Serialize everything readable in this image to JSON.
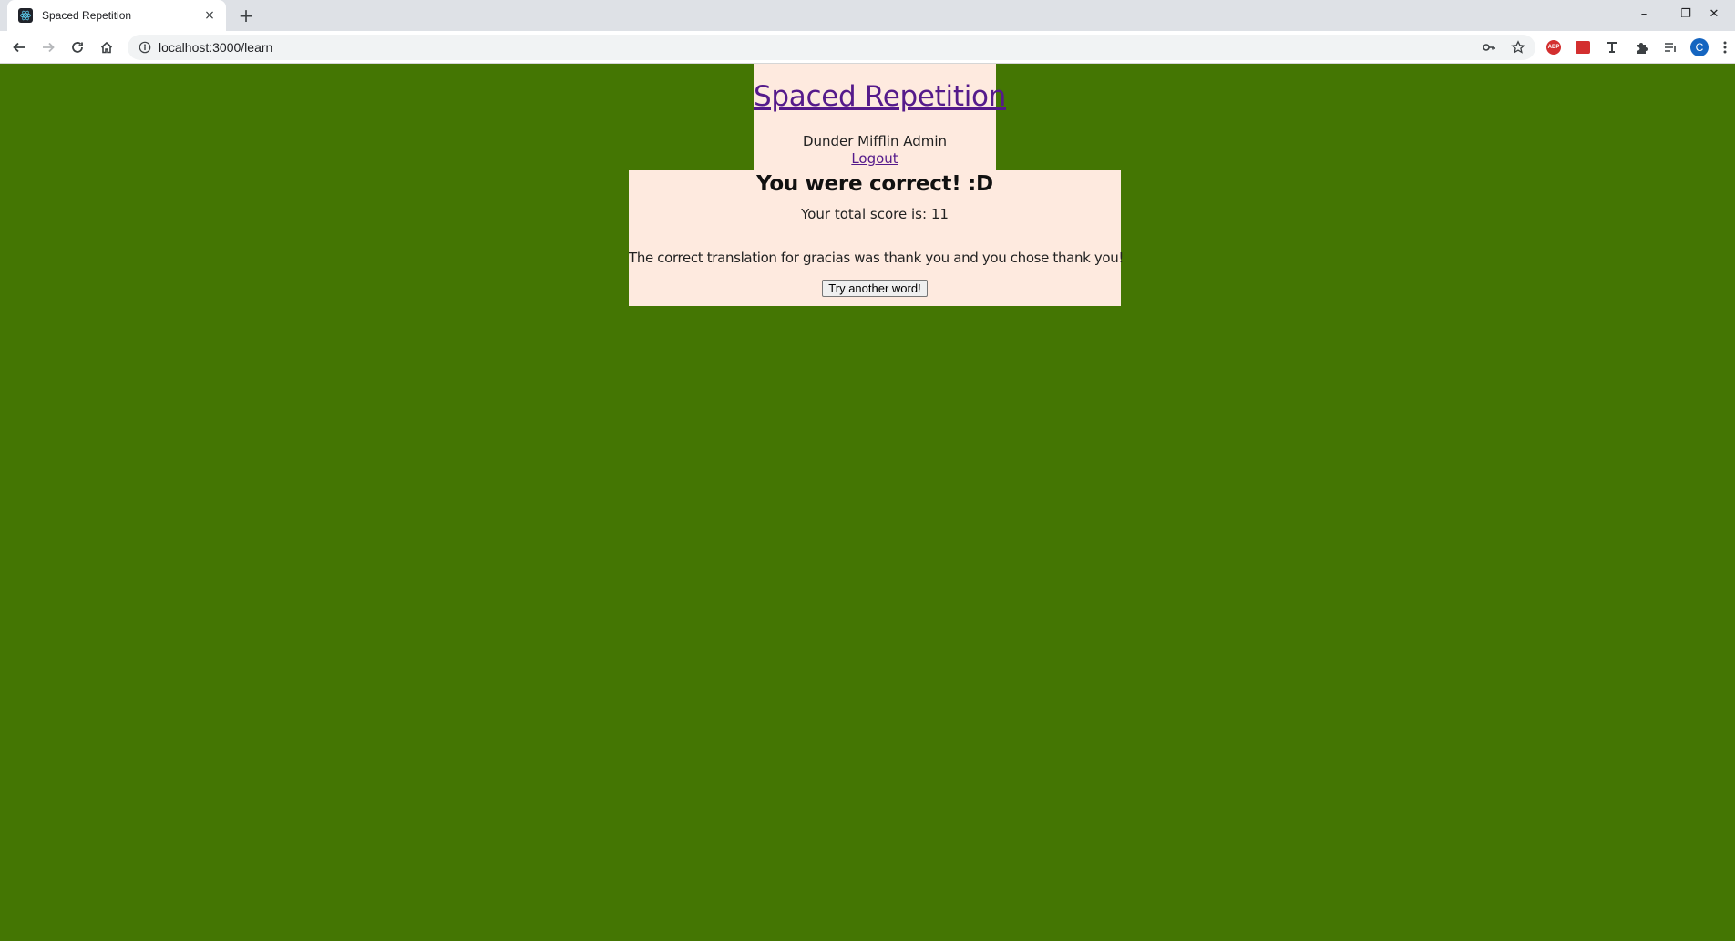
{
  "browser": {
    "tab_title": "Spaced Repetition",
    "tab_close": "×",
    "new_tab": "+",
    "url": "localhost:3000/learn",
    "profile_initial": "C",
    "extension_abp": "ABP",
    "window_minimize": "–",
    "window_restore": "❐",
    "window_close": "✕"
  },
  "header": {
    "title": "Spaced Repetition",
    "user_name": "Dunder Mifflin Admin",
    "logout_label": "Logout"
  },
  "feedback": {
    "heading": "You were correct! :D",
    "score_text": "Your total score is: 11",
    "translation_text": "The correct translation for gracias was thank you and you chose thank you!",
    "button_label": "Try another word!"
  },
  "colors": {
    "page_background": "#447603",
    "panel_background": "#feeadf",
    "link": "#551a8b"
  }
}
